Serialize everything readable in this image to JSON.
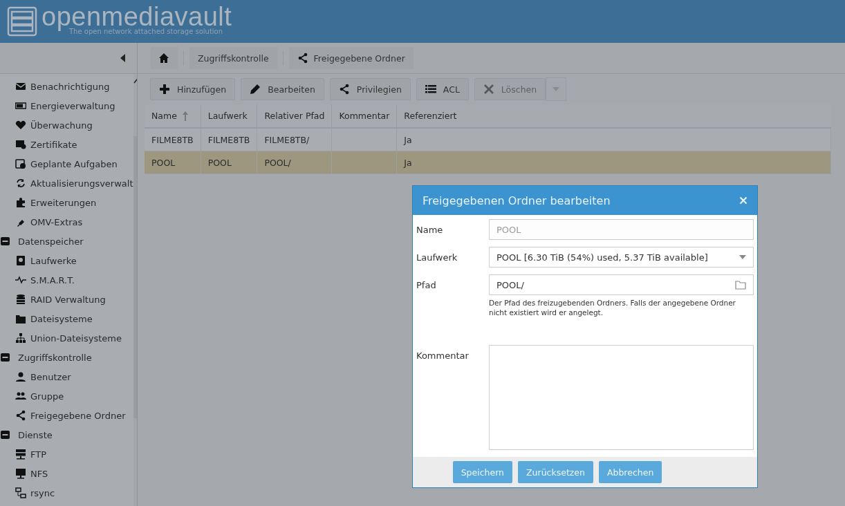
{
  "header": {
    "logo": "openmediavault",
    "tagline": "The open network attached storage solution"
  },
  "breadcrumb": [
    {
      "label": "Zugriffskontrolle"
    },
    {
      "label": "Freigegebene Ordner"
    }
  ],
  "sidebar": {
    "groups": [
      {
        "children": [
          {
            "label": "Benachrichtigung"
          },
          {
            "label": "Energieverwaltung"
          },
          {
            "label": "Überwachung"
          },
          {
            "label": "Zertifikate"
          },
          {
            "label": "Geplante Aufgaben"
          },
          {
            "label": "Aktualisierungsverwalt"
          },
          {
            "label": "Erweiterungen"
          },
          {
            "label": "OMV-Extras"
          }
        ]
      },
      {
        "label": "Datenspeicher",
        "expanded": true,
        "children": [
          {
            "label": "Laufwerke"
          },
          {
            "label": "S.M.A.R.T."
          },
          {
            "label": "RAID Verwaltung"
          },
          {
            "label": "Dateisysteme"
          },
          {
            "label": "Union-Dateisysteme"
          }
        ]
      },
      {
        "label": "Zugriffskontrolle",
        "expanded": true,
        "children": [
          {
            "label": "Benutzer"
          },
          {
            "label": "Gruppe"
          },
          {
            "label": "Freigegebene Ordner"
          }
        ]
      },
      {
        "label": "Dienste",
        "expanded": true,
        "children": [
          {
            "label": "FTP"
          },
          {
            "label": "NFS"
          },
          {
            "label": "rsync"
          }
        ]
      }
    ]
  },
  "toolbar": [
    {
      "label": "Hinzufügen",
      "disabled": false
    },
    {
      "label": "Bearbeiten",
      "disabled": false
    },
    {
      "label": "Privilegien",
      "disabled": false
    },
    {
      "label": "ACL",
      "disabled": false
    },
    {
      "label": "Löschen",
      "disabled": true
    }
  ],
  "table": {
    "columns": [
      {
        "label": "Name",
        "sorted": true
      },
      {
        "label": "Laufwerk",
        "sorted": false
      },
      {
        "label": "Relativer Pfad",
        "sorted": false
      },
      {
        "label": "Kommentar",
        "sorted": false
      },
      {
        "label": "Referenziert",
        "sorted": false
      }
    ],
    "rows": [
      {
        "cells": [
          "FILME8TB",
          "FILME8TB",
          "FILME8TB/",
          "",
          "Ja"
        ],
        "selected": false
      },
      {
        "cells": [
          "POOL",
          "POOL",
          "POOL/",
          "",
          "Ja"
        ],
        "selected": true
      }
    ]
  },
  "dialog": {
    "title": "Freigegebenen Ordner bearbeiten",
    "fields": [
      {
        "kind": "text",
        "label": "Name",
        "value": "POOL",
        "disabled": true
      },
      {
        "kind": "select",
        "label": "Laufwerk",
        "value": "POOL [6.30 TiB (54%) used, 5.37 TiB available]"
      },
      {
        "kind": "path",
        "label": "Pfad",
        "value": "POOL/",
        "hint": "Der Pfad des freizugebenden Ordners. Falls der angegebene Ordner nicht existiert wird er angelegt."
      },
      {
        "kind": "textarea",
        "label": "Kommentar"
      }
    ],
    "buttons": [
      "Speichern",
      "Zurücksetzen",
      "Abbrechen"
    ]
  }
}
